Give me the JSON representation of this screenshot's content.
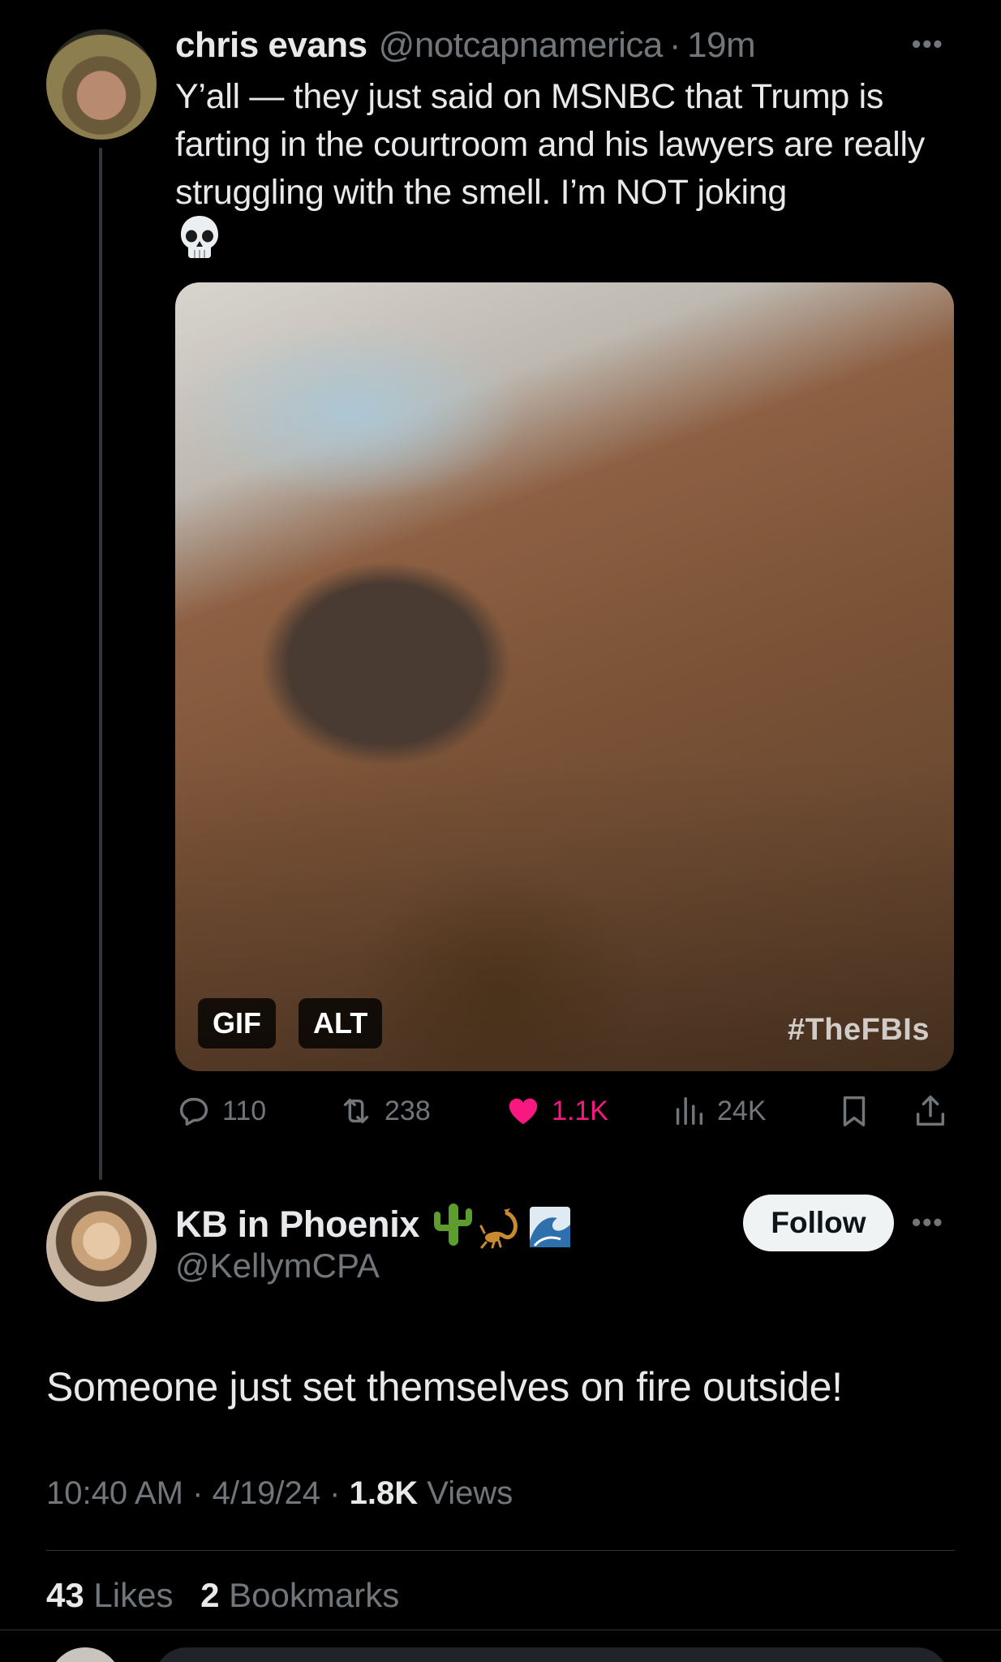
{
  "tweet": {
    "author_name": "chris evans",
    "author_handle": "@notcapnamerica",
    "separator": "·",
    "time": "19m",
    "text": "Y’all — they just said on MSNBC that Trump is farting in the courtroom and his lawyers are really struggling with the smell. I’m NOT joking",
    "emoji": "skull-emoji",
    "more_icon": "more-dots-icon",
    "media": {
      "badge_gif": "GIF",
      "badge_alt": "ALT",
      "watermark": "#TheFBIs"
    },
    "actions": {
      "replies": "110",
      "retweets": "238",
      "likes": "1.1K",
      "views": "24K"
    }
  },
  "reply": {
    "author_name": "KB in Phoenix",
    "name_emojis": [
      "cactus-emoji",
      "scorpion-emoji",
      "wave-emoji"
    ],
    "author_handle": "@KellymCPA",
    "follow_label": "Follow",
    "text": "Someone just set themselves on fire outside!",
    "time": "10:40 AM",
    "date": "4/19/24",
    "views_count": "1.8K",
    "views_label": "Views",
    "likes_count": "43",
    "likes_label": "Likes",
    "bookmarks_count": "2",
    "bookmarks_label": "Bookmarks"
  },
  "colors": {
    "background": "#000000",
    "text": "#e7e9ea",
    "secondary": "#71767b",
    "like_active": "#f91880",
    "follow_bg": "#eff3f4"
  }
}
